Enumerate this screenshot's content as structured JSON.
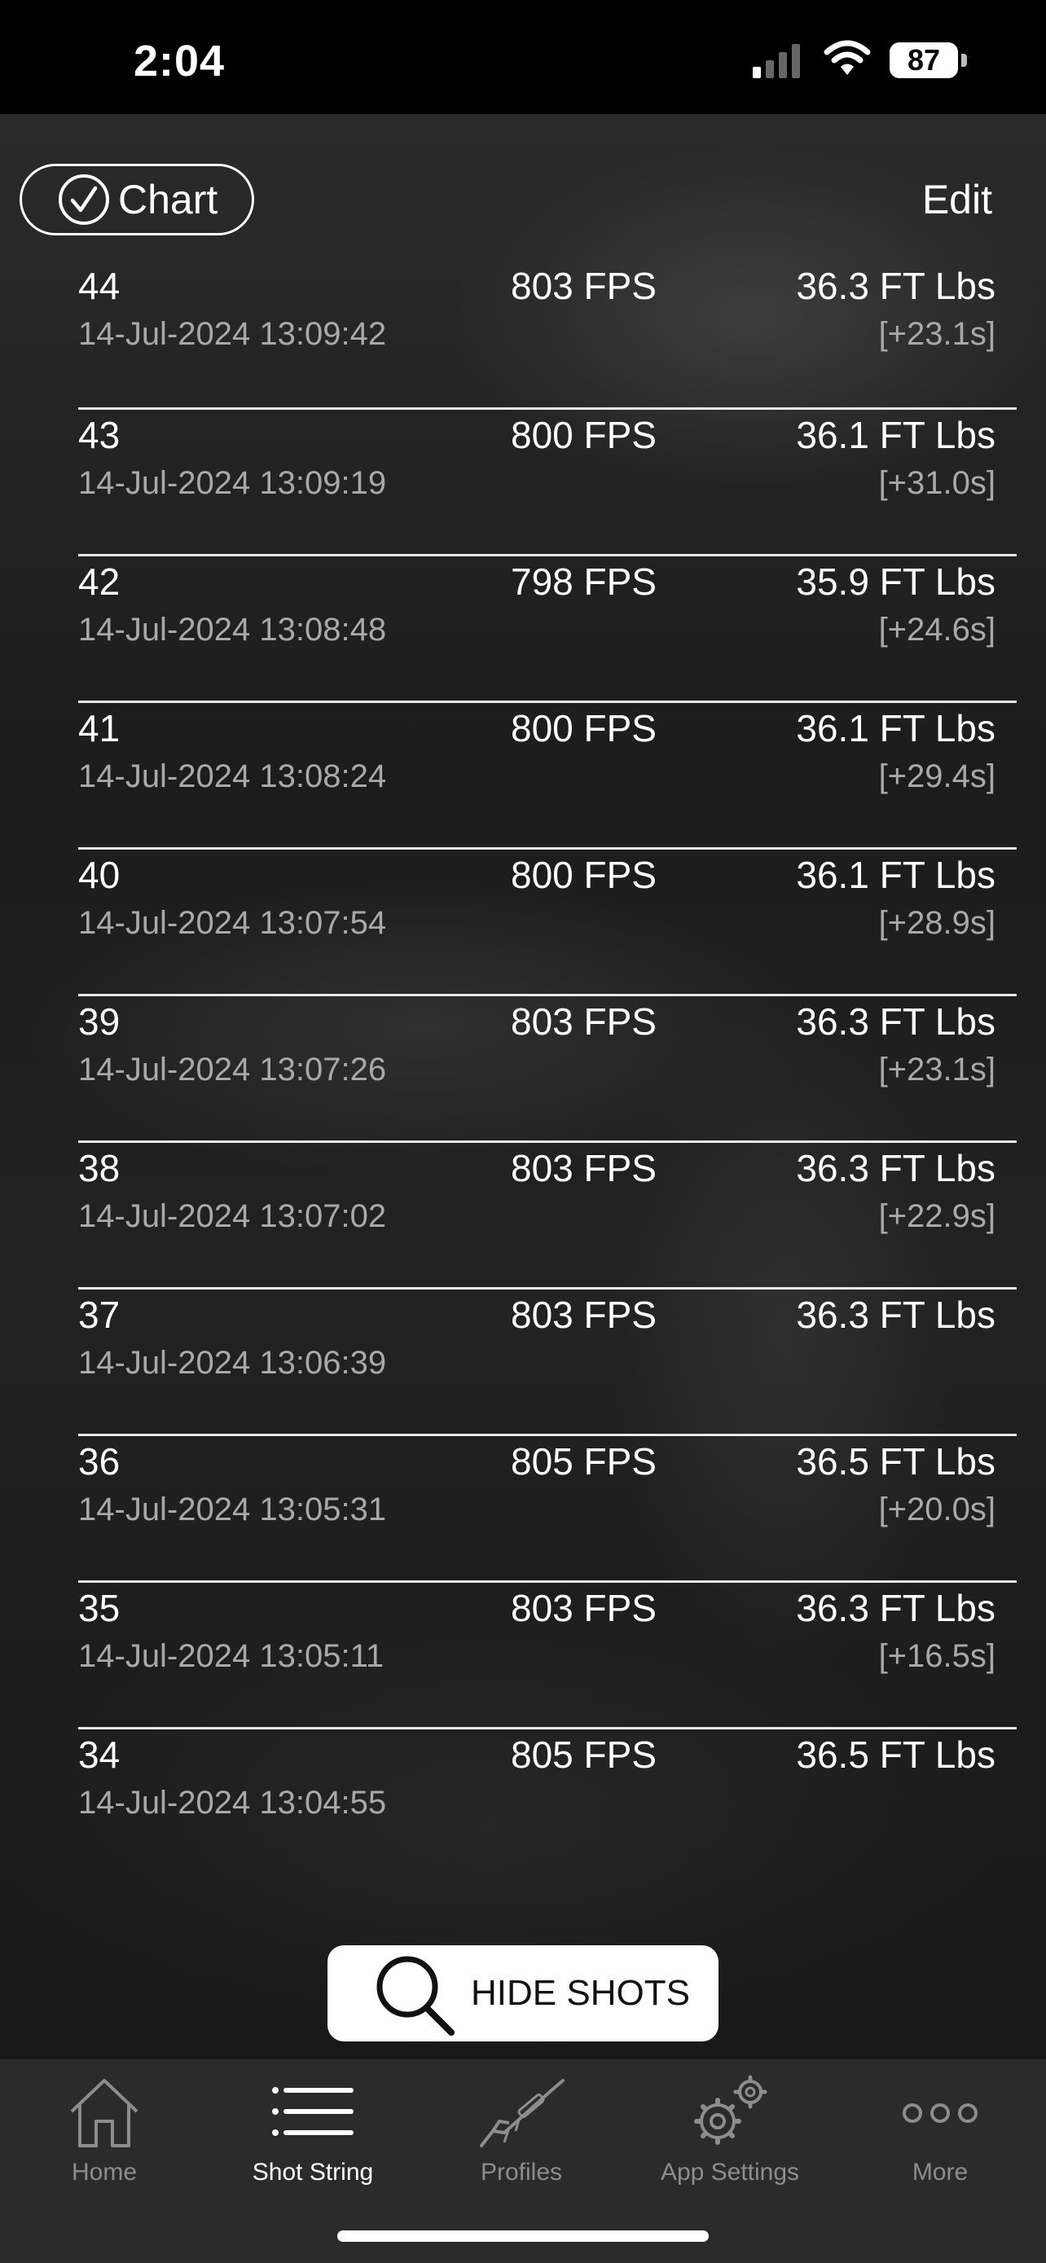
{
  "status_bar": {
    "time": "2:04",
    "battery": "87"
  },
  "header": {
    "chart_label": "Chart",
    "edit_label": "Edit"
  },
  "shots": [
    {
      "number": "44",
      "fps": "803 FPS",
      "energy": "36.3 FT Lbs",
      "timestamp": "14-Jul-2024 13:09:42",
      "interval": "[+23.1s]"
    },
    {
      "number": "43",
      "fps": "800 FPS",
      "energy": "36.1 FT Lbs",
      "timestamp": "14-Jul-2024 13:09:19",
      "interval": "[+31.0s]"
    },
    {
      "number": "42",
      "fps": "798 FPS",
      "energy": "35.9 FT Lbs",
      "timestamp": "14-Jul-2024 13:08:48",
      "interval": "[+24.6s]"
    },
    {
      "number": "41",
      "fps": "800 FPS",
      "energy": "36.1 FT Lbs",
      "timestamp": "14-Jul-2024 13:08:24",
      "interval": "[+29.4s]"
    },
    {
      "number": "40",
      "fps": "800 FPS",
      "energy": "36.1 FT Lbs",
      "timestamp": "14-Jul-2024 13:07:54",
      "interval": "[+28.9s]"
    },
    {
      "number": "39",
      "fps": "803 FPS",
      "energy": "36.3 FT Lbs",
      "timestamp": "14-Jul-2024 13:07:26",
      "interval": "[+23.1s]"
    },
    {
      "number": "38",
      "fps": "803 FPS",
      "energy": "36.3 FT Lbs",
      "timestamp": "14-Jul-2024 13:07:02",
      "interval": "[+22.9s]"
    },
    {
      "number": "37",
      "fps": "803 FPS",
      "energy": "36.3 FT Lbs",
      "timestamp": "14-Jul-2024 13:06:39",
      "interval": ""
    },
    {
      "number": "36",
      "fps": "805 FPS",
      "energy": "36.5 FT Lbs",
      "timestamp": "14-Jul-2024 13:05:31",
      "interval": "[+20.0s]"
    },
    {
      "number": "35",
      "fps": "803 FPS",
      "energy": "36.3 FT Lbs",
      "timestamp": "14-Jul-2024 13:05:11",
      "interval": "[+16.5s]"
    },
    {
      "number": "34",
      "fps": "805 FPS",
      "energy": "36.5 FT Lbs",
      "timestamp": "14-Jul-2024 13:04:55",
      "interval": ""
    }
  ],
  "hide_shots_label": "HIDE SHOTS",
  "tab_bar": {
    "tabs": [
      {
        "label": "Home",
        "icon": "house-icon",
        "active": false
      },
      {
        "label": "Shot String",
        "icon": "list-icon",
        "active": true
      },
      {
        "label": "Profiles",
        "icon": "rifle-icon",
        "active": false
      },
      {
        "label": "App Settings",
        "icon": "gears-icon",
        "active": false
      },
      {
        "label": "More",
        "icon": "more-dots-icon",
        "active": false
      }
    ]
  }
}
